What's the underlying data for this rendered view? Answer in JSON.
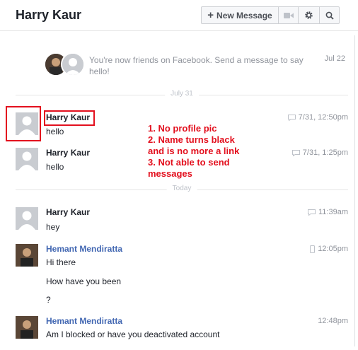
{
  "header": {
    "title": "Harry Kaur",
    "new_message_label": "New Message"
  },
  "friends_notice": {
    "text": "You're now friends on Facebook. Send a message to say hello!",
    "date": "Jul 22"
  },
  "dividers": {
    "july31": "July 31",
    "today": "Today"
  },
  "messages": [
    {
      "sender": "Harry Kaur",
      "text": "hello",
      "time": "7/31, 12:50pm"
    },
    {
      "sender": "Harry Kaur",
      "text": "hello",
      "time": "7/31, 1:25pm"
    },
    {
      "sender": "Harry Kaur",
      "text": "hey",
      "time": "11:39am"
    },
    {
      "sender": "Hemant Mendiratta",
      "lines": [
        "Hi there",
        "How have you been",
        "?"
      ],
      "time": "12:05pm"
    },
    {
      "sender": "Hemant Mendiratta",
      "text": "Am I blocked or have you deactivated account",
      "time": "12:48pm"
    }
  ],
  "annotation": {
    "lines": [
      "1. No profile pic",
      "2. Name turns black",
      "and is no more a link",
      "3. Not able to send",
      "messages"
    ]
  },
  "colors": {
    "link": "#4267b2",
    "annotation": "#e3101e",
    "meta_gray": "#90949c"
  }
}
